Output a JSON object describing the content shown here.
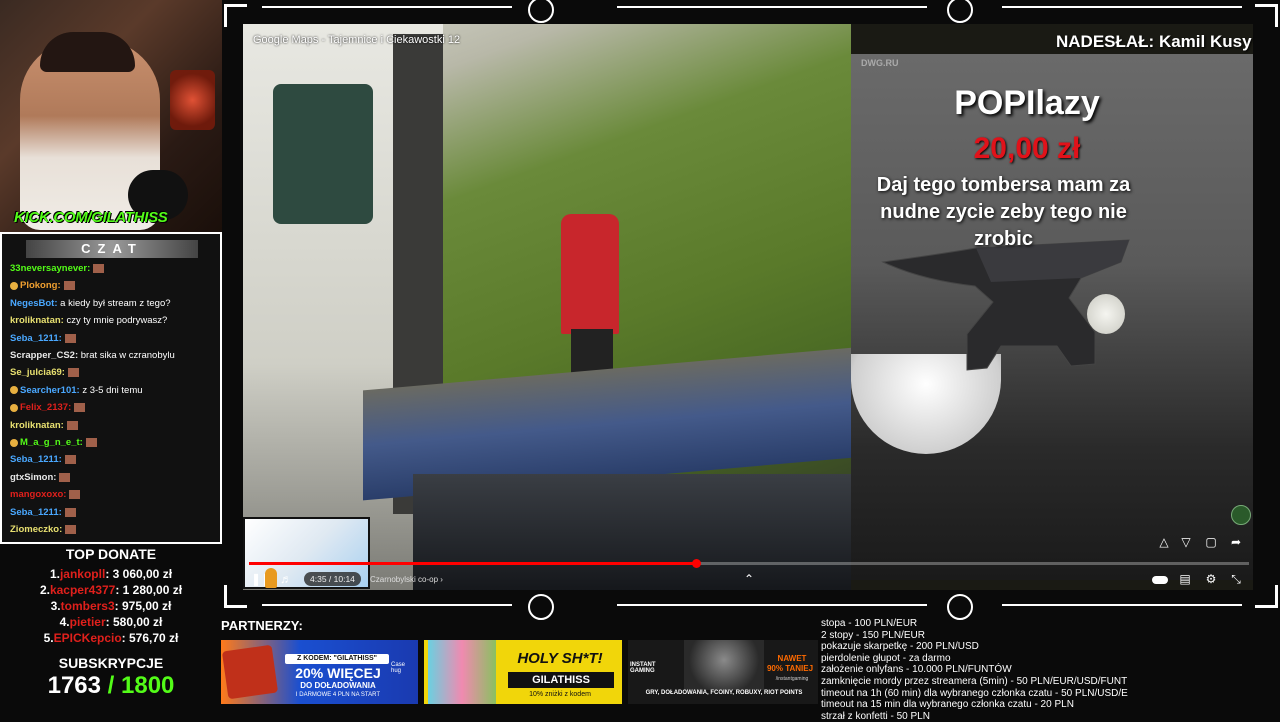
{
  "webcam": {
    "url_text": "KICK.COM/GILATHISS"
  },
  "chat": {
    "title": "CZAT",
    "messages": [
      {
        "user": "33neversaynever:",
        "text": "",
        "color": "#53fc18",
        "emote": true
      },
      {
        "user": "Plokong:",
        "text": "",
        "color": "#f0a030",
        "emote": true,
        "badge": true
      },
      {
        "user": "NegesBot:",
        "text": "a kiedy był stream z tego?",
        "color": "#4aa8ff",
        "emote": false
      },
      {
        "user": "kroliknatan:",
        "text": "czy ty mnie podrywasz?",
        "color": "#e8e070",
        "emote": false
      },
      {
        "user": "Seba_1211:",
        "text": "",
        "color": "#4aa8ff",
        "emote": true
      },
      {
        "user": "Scrapper_CS2:",
        "text": "brat sika w czranobylu",
        "color": "#e8e8e8",
        "emote": false
      },
      {
        "user": "Se_julcia69:",
        "text": "",
        "color": "#e8e070",
        "emote": true
      },
      {
        "user": "Searcher101:",
        "text": "z 3-5 dni temu",
        "color": "#4aa8ff",
        "emote": false,
        "badge": true
      },
      {
        "user": "Felix_2137:",
        "text": "",
        "color": "#e0201c",
        "emote": true,
        "badge": true
      },
      {
        "user": "kroliknatan:",
        "text": "",
        "color": "#e8e070",
        "emote": true
      },
      {
        "user": "M_a_g_n_e_t:",
        "text": "",
        "color": "#53fc18",
        "emote": true,
        "badge": true
      },
      {
        "user": "Seba_1211:",
        "text": "",
        "color": "#4aa8ff",
        "emote": true
      },
      {
        "user": "gtxSimon:",
        "text": "",
        "color": "#e8e8e8",
        "emote": true
      },
      {
        "user": "mangoxoxo:",
        "text": "",
        "color": "#e0201c",
        "emote": true
      },
      {
        "user": "Seba_1211:",
        "text": "",
        "color": "#4aa8ff",
        "emote": true
      },
      {
        "user": "Ziomeczko:",
        "text": "",
        "color": "#e8e070",
        "emote": true
      }
    ]
  },
  "top_donate": {
    "title": "TOP DONATE",
    "rows": [
      {
        "rank": "1.",
        "name": "jankopll",
        "amount": ": 3 060,00 zł"
      },
      {
        "rank": "2.",
        "name": "kacper4377",
        "amount": ": 1 280,00 zł"
      },
      {
        "rank": "3.",
        "name": "tombers3",
        "amount": ": 975,00 zł"
      },
      {
        "rank": "4.",
        "name": "pietier",
        "amount": ": 580,00 zł"
      },
      {
        "rank": "5.",
        "name": "EPICKepcio",
        "amount": ": 576,70 zł"
      }
    ]
  },
  "subs": {
    "title": "SUBSKRYPCJE",
    "count": "1763",
    "goal": "/ 1800"
  },
  "video": {
    "title": "Google Maps - Tajemnice i Ciekawostki 12",
    "sender": "NADESŁAŁ: Kamil Kusy",
    "time": "4:35 / 10:14",
    "chapter": "Czarnobylski co-op",
    "progress": 0.447,
    "watermark": "DWG.RU"
  },
  "donation_alert": {
    "name": "POPIlazy",
    "amount": "20,00 zł",
    "message": "Daj tego tombersa mam za nudne zycie zeby tego nie zrobic"
  },
  "partners": {
    "title": "PARTNERZY:",
    "banners": [
      {
        "code_label": "Z KODEM: \"GILATHISS\"",
        "headline": "20% WIĘCEJ",
        "sub": "DO DOŁADOWANIA",
        "footer": "I DARMOWE 4 PLN NA START",
        "brand": "Case\nhug"
      },
      {
        "headline": "HOLY SH*T!",
        "sub": "GILATHISS",
        "footer": "10% zniżki z kodem"
      },
      {
        "brand": "INSTANT GAMING",
        "tag": "NAWET",
        "headline": "90% TANIEJ",
        "footer": "GRY, DOŁADOWANIA, FCOINY, ROBUXY, RIOT POINTS",
        "handle": "/instantgaming"
      }
    ]
  },
  "price_list": [
    "stopa - 100 PLN/EUR",
    "2 stopy - 150 PLN/EUR",
    "pokazuje skarpetkę - 200 PLN/USD",
    "pierdolenie głupot - za darmo",
    "założenie onlyfans - 10.000 PLN/FUNTÓW",
    "zamknięcie mordy przez streamera (5min) - 50 PLN/EUR/USD/FUNT",
    "timeout na 1h (60 min) dla wybranego członka czatu - 50 PLN/USD/E",
    "timeout na 15 min dla wybranego członka czatu - 20 PLN",
    "strzał z konfetti - 50 PLN"
  ]
}
